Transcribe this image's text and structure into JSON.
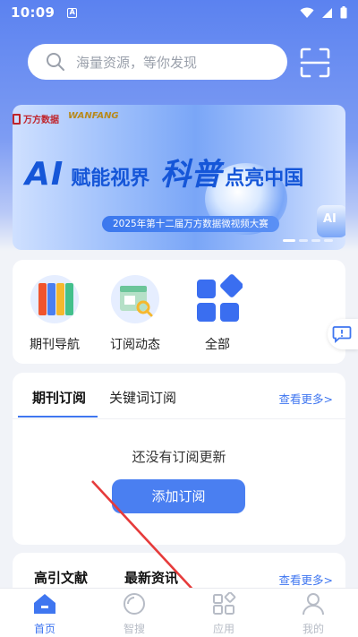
{
  "status": {
    "time": "10:09",
    "badge": "A"
  },
  "search": {
    "placeholder": "海量资源，等你发现"
  },
  "banner": {
    "logo_left": "万方数据",
    "logo_right": "WANFANG",
    "headline_ai": "AI",
    "headline_1": "赋能视界",
    "headline_2": "科普",
    "headline_3": "点亮中国",
    "subtitle": "2025年第十二届万方数据微视频大赛",
    "robot_label": "AI"
  },
  "quick": {
    "items": [
      {
        "label": "期刊导航",
        "icon": "journal-books-icon"
      },
      {
        "label": "订阅动态",
        "icon": "subscription-feed-icon"
      },
      {
        "label": "全部",
        "icon": "all-apps-icon"
      }
    ]
  },
  "subscription": {
    "tabs": [
      "期刊订阅",
      "关键词订阅"
    ],
    "more": "查看更多>",
    "empty": "还没有订阅更新",
    "add_button": "添加订阅"
  },
  "cite": {
    "tabs": [
      "高引文献",
      "最新资讯"
    ],
    "more": "查看更多>"
  },
  "nav": {
    "items": [
      {
        "label": "首页",
        "icon": "home-icon",
        "active": true
      },
      {
        "label": "智搜",
        "icon": "smart-search-icon",
        "active": false
      },
      {
        "label": "应用",
        "icon": "apps-icon",
        "active": false
      },
      {
        "label": "我的",
        "icon": "profile-icon",
        "active": false
      }
    ]
  },
  "colors": {
    "accent": "#3f76f0",
    "button": "#4a7ff1",
    "header": "#5b82f0"
  }
}
